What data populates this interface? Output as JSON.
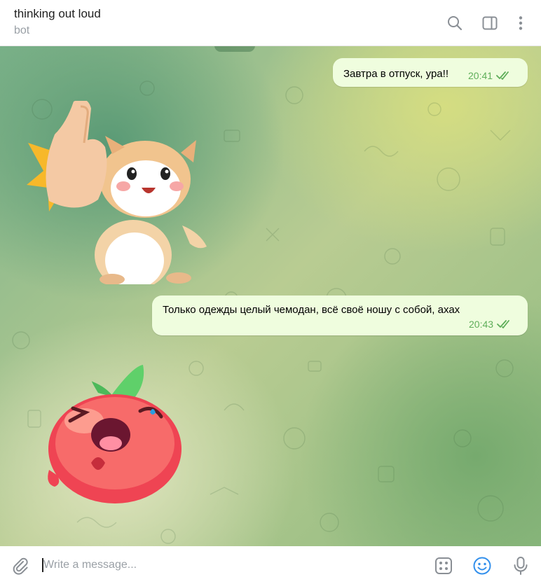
{
  "header": {
    "title": "thinking out loud",
    "subtitle": "bot",
    "icons": [
      "search-icon",
      "sidebar-toggle-icon",
      "more-vertical-icon"
    ]
  },
  "messages": [
    {
      "type": "text",
      "direction": "outgoing",
      "text": "Завтра в отпуск, ура!!",
      "time": "20:41",
      "status": "read"
    },
    {
      "type": "sticker",
      "direction": "incoming",
      "sticker": "hamster-thumbs-up"
    },
    {
      "type": "text",
      "direction": "outgoing",
      "text": "Только одежды целый чемодан, всё своё ношу с собой, ахах",
      "time": "20:43",
      "status": "read"
    },
    {
      "type": "sticker",
      "direction": "incoming",
      "sticker": "peach-laughing"
    }
  ],
  "composer": {
    "placeholder": "Write a message...",
    "icons": [
      "attach-icon",
      "bot-commands-icon",
      "emoji-icon",
      "microphone-icon"
    ]
  },
  "colors": {
    "accent": "#3390ec",
    "bubble_out": "#effdde",
    "time_out": "#5fae5a",
    "wallpaper": [
      "#7db38a",
      "#d6de80",
      "#dee4be",
      "#76aa6e"
    ]
  }
}
